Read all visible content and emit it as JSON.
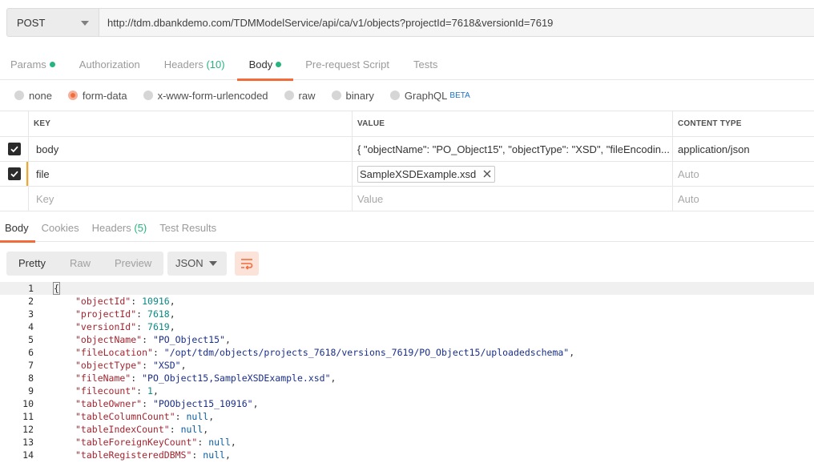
{
  "request": {
    "method": "POST",
    "url": "http://tdm.dbankdemo.com/TDMModelService/api/ca/v1/objects?projectId=7618&versionId=7619"
  },
  "request_tabs": [
    {
      "label": "Params",
      "badge": "dot"
    },
    {
      "label": "Authorization"
    },
    {
      "label": "Headers",
      "count": "(10)"
    },
    {
      "label": "Body",
      "badge": "dot",
      "active": true
    },
    {
      "label": "Pre-request Script"
    },
    {
      "label": "Tests"
    }
  ],
  "body_types": {
    "none": "none",
    "form_data": "form-data",
    "urlencoded": "x-www-form-urlencoded",
    "raw": "raw",
    "binary": "binary",
    "graphql": "GraphQL",
    "graphql_badge": "BETA",
    "selected": "form-data"
  },
  "form_table": {
    "headers": {
      "key": "KEY",
      "value": "VALUE",
      "content_type": "CONTENT TYPE"
    },
    "rows": [
      {
        "key": "body",
        "value": "{ \"objectName\": \"PO_Object15\",  \"objectType\": \"XSD\",  \"fileEncodin...",
        "content_type": "application/json",
        "checked": true
      },
      {
        "key": "file",
        "value": "SampleXSDExample.xsd",
        "content_type": "Auto",
        "checked": true
      }
    ],
    "new_row": {
      "key_placeholder": "Key",
      "value_placeholder": "Value",
      "content_type": "Auto"
    }
  },
  "response_tabs": [
    {
      "label": "Body",
      "active": true
    },
    {
      "label": "Cookies"
    },
    {
      "label": "Headers",
      "count": "(5)"
    },
    {
      "label": "Test Results"
    }
  ],
  "response_toolbar": {
    "views": [
      "Pretty",
      "Raw",
      "Preview"
    ],
    "active_view": "Pretty",
    "format": "JSON",
    "wrap_icon": "wrap-lines-icon"
  },
  "response_code": {
    "open": "{",
    "lines": [
      {
        "key": "\"objectId\"",
        "value": "10916",
        "type": "number"
      },
      {
        "key": "\"projectId\"",
        "value": "7618",
        "type": "number"
      },
      {
        "key": "\"versionId\"",
        "value": "7619",
        "type": "number"
      },
      {
        "key": "\"objectName\"",
        "value": "\"PO_Object15\"",
        "type": "string"
      },
      {
        "key": "\"fileLocation\"",
        "value": "\"/opt/tdm/objects/projects_7618/versions_7619/PO_Object15/uploadedschema\"",
        "type": "string"
      },
      {
        "key": "\"objectType\"",
        "value": "\"XSD\"",
        "type": "string"
      },
      {
        "key": "\"fileName\"",
        "value": "\"PO_Object15,SampleXSDExample.xsd\"",
        "type": "string"
      },
      {
        "key": "\"filecount\"",
        "value": "1",
        "type": "number"
      },
      {
        "key": "\"tableOwner\"",
        "value": "\"POObject15_10916\"",
        "type": "string"
      },
      {
        "key": "\"tableColumnCount\"",
        "value": "null",
        "type": "null"
      },
      {
        "key": "\"tableIndexCount\"",
        "value": "null",
        "type": "null"
      },
      {
        "key": "\"tableForeignKeyCount\"",
        "value": "null",
        "type": "null"
      },
      {
        "key": "\"tableRegisteredDBMS\"",
        "value": "null",
        "type": "null"
      }
    ]
  },
  "colors": {
    "accent": "#f26b3a",
    "success": "#26b47f",
    "json_key": "#a4252f",
    "json_number": "#0b8a86",
    "json_string": "#1a2f8a"
  }
}
